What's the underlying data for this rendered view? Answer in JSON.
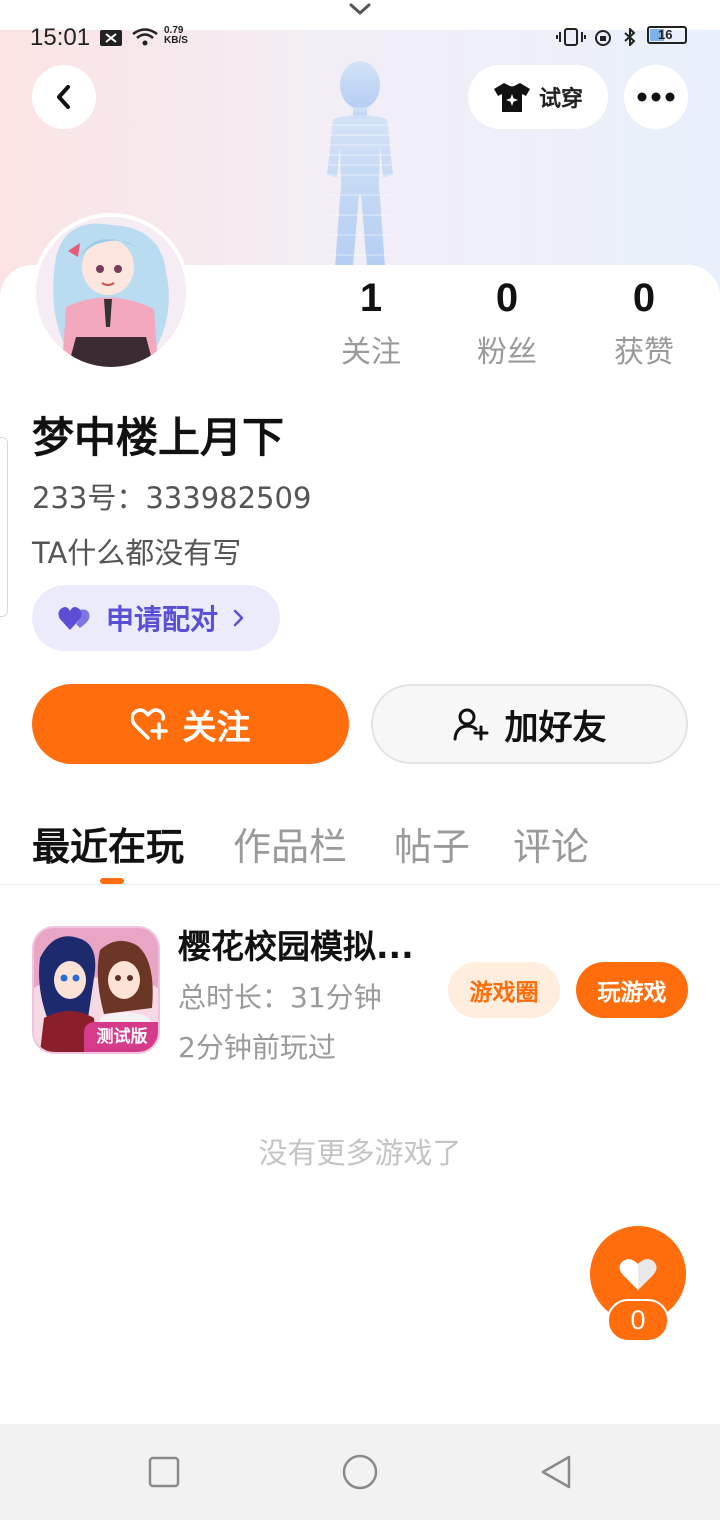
{
  "status_bar": {
    "time": "15:01",
    "net_speed_value": "0.79",
    "net_speed_unit": "KB/S",
    "battery": "16"
  },
  "header": {
    "try_on_label": "试穿"
  },
  "stats": [
    {
      "value": "1",
      "label": "关注"
    },
    {
      "value": "0",
      "label": "粉丝"
    },
    {
      "value": "0",
      "label": "获赞"
    }
  ],
  "profile": {
    "name": "梦中楼上月下",
    "id_text": "233号：333982509",
    "bio": "TA什么都没有写",
    "pair_label": "申请配对"
  },
  "actions": {
    "follow_label": "关注",
    "add_friend_label": "加好友"
  },
  "tabs": [
    "最近在玩",
    "作品栏",
    "帖子",
    "评论"
  ],
  "game": {
    "title": "樱花校园模拟...",
    "duration": "总时长：31分钟",
    "last_played": "2分钟前玩过",
    "badge": "测试版",
    "circle_label": "游戏圈",
    "play_label": "玩游戏"
  },
  "empty_text": "没有更多游戏了",
  "like": {
    "count": "0"
  },
  "colors": {
    "accent": "#ff6d0c",
    "pair": "#5b4fd6",
    "pair_bg": "#ecebfb"
  }
}
